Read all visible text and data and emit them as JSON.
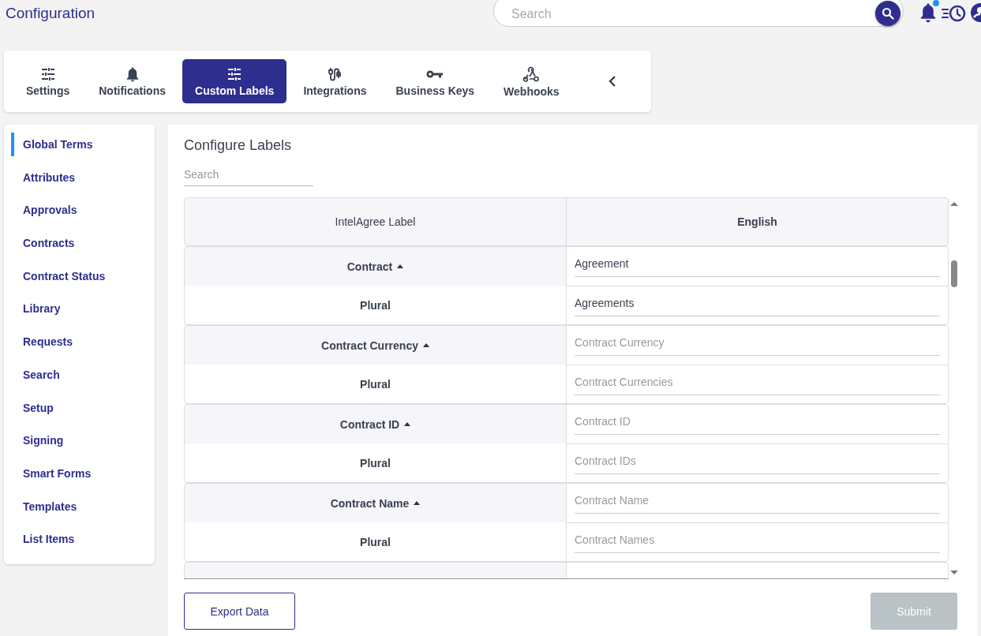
{
  "header": {
    "title": "Configuration",
    "search": {
      "placeholder": "Search"
    },
    "notification_badge": true
  },
  "tabs": [
    {
      "label": "Settings",
      "kind": "sliders",
      "selected": false
    },
    {
      "label": "Notifications",
      "kind": "bell",
      "selected": false
    },
    {
      "label": "Custom Labels",
      "kind": "sliders",
      "selected": true
    },
    {
      "label": "Integrations",
      "kind": "plug",
      "selected": false
    },
    {
      "label": "Business Keys",
      "kind": "key",
      "selected": false
    },
    {
      "label": "Webhooks",
      "kind": "webhook",
      "selected": false
    }
  ],
  "sidebar": {
    "items": [
      {
        "label": "Global Terms",
        "selected": true
      },
      {
        "label": "Attributes",
        "selected": false
      },
      {
        "label": "Approvals",
        "selected": false
      },
      {
        "label": "Contracts",
        "selected": false
      },
      {
        "label": "Contract Status",
        "selected": false
      },
      {
        "label": "Library",
        "selected": false
      },
      {
        "label": "Requests",
        "selected": false
      },
      {
        "label": "Search",
        "selected": false
      },
      {
        "label": "Setup",
        "selected": false
      },
      {
        "label": "Signing",
        "selected": false
      },
      {
        "label": "Smart Forms",
        "selected": false
      },
      {
        "label": "Templates",
        "selected": false
      },
      {
        "label": "List Items",
        "selected": false
      }
    ]
  },
  "panel": {
    "title": "Configure Labels",
    "search": {
      "placeholder": "Search"
    },
    "table": {
      "columns": [
        "IntelAgree Label",
        "English"
      ],
      "groups": [
        {
          "label": "Contract",
          "expanded": true,
          "field": {
            "value": "Agreement"
          },
          "plural": {
            "label": "Plural",
            "field": {
              "value": "Agreements"
            }
          }
        },
        {
          "label": "Contract Currency",
          "expanded": true,
          "field": {
            "placeholder": "Contract Currency"
          },
          "plural": {
            "label": "Plural",
            "field": {
              "placeholder": "Contract Currencies"
            }
          }
        },
        {
          "label": "Contract ID",
          "expanded": true,
          "field": {
            "placeholder": "Contract ID"
          },
          "plural": {
            "label": "Plural",
            "field": {
              "placeholder": "Contract IDs"
            }
          }
        },
        {
          "label": "Contract Name",
          "expanded": true,
          "field": {
            "placeholder": "Contract Name"
          },
          "plural": {
            "label": "Plural",
            "field": {
              "placeholder": "Contract Names"
            }
          }
        }
      ]
    }
  },
  "buttons": [
    {
      "label": "Export Data",
      "kind": "outline",
      "disabled": false
    },
    {
      "label": "Submit",
      "kind": "primary",
      "disabled": true
    }
  ]
}
